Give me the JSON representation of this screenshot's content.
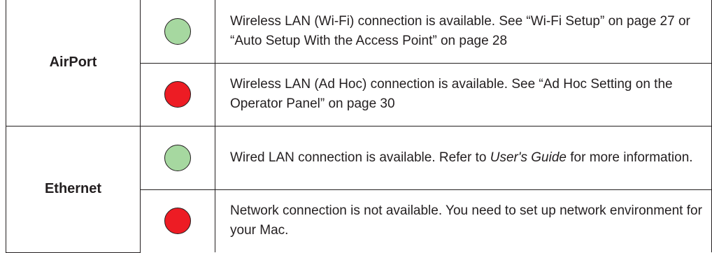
{
  "rows": [
    {
      "connection": "AirPort",
      "states": [
        {
          "light": "green-circle",
          "color": "#a6d8a0",
          "description": "Wireless LAN (Wi-Fi) connection is available. See “Wi-Fi Setup” on page 27 or “Auto Setup With the Access Point” on page 28"
        },
        {
          "light": "red-circle",
          "color": "#ed1c24",
          "description": "Wireless LAN (Ad Hoc) connection is available. See “Ad Hoc Setting on the Operator Panel” on page 30"
        }
      ]
    },
    {
      "connection": "Ethernet",
      "states": [
        {
          "light": "green-circle",
          "color": "#a6d8a0",
          "description_before": "Wired LAN connection is available. Refer to ",
          "description_italic": "User's Guide",
          "description_after": " for more information."
        },
        {
          "light": "red-circle",
          "color": "#ed1c24",
          "description": "Network connection is not available. You need to set up network environment for your Mac."
        }
      ]
    }
  ]
}
